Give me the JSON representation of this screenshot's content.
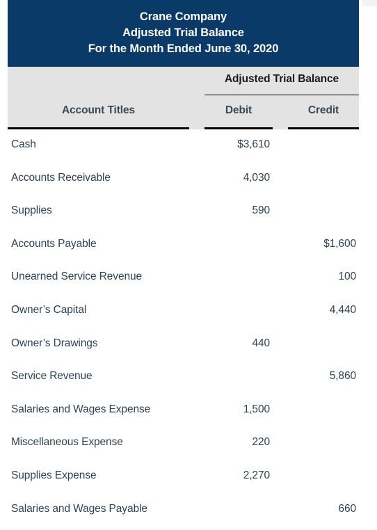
{
  "colors": {
    "header_blue": "#0a3a68",
    "header_grey": "#e3e3e3",
    "rule_black": "#000000",
    "body_text": "#2f4254",
    "page_background": "#ffffff"
  },
  "title_block": {
    "company": "Crane Company",
    "statement": "Adjusted Trial Balance",
    "period": "For the Month Ended June 30, 2020"
  },
  "table": {
    "group_header": "Adjusted Trial Balance",
    "columns": {
      "accounts": "Account Titles",
      "debit": "Debit",
      "credit": "Credit"
    },
    "rows": [
      {
        "account": "Cash",
        "debit": "$3,610",
        "credit": ""
      },
      {
        "account": "Accounts Receivable",
        "debit": "4,030",
        "credit": ""
      },
      {
        "account": "Supplies",
        "debit": "590",
        "credit": ""
      },
      {
        "account": "Accounts Payable",
        "debit": "",
        "credit": "$1,600"
      },
      {
        "account": "Unearned Service Revenue",
        "debit": "",
        "credit": "100"
      },
      {
        "account": "Owner’s Capital",
        "debit": "",
        "credit": "4,440"
      },
      {
        "account": "Owner’s Drawings",
        "debit": "440",
        "credit": ""
      },
      {
        "account": "Service Revenue",
        "debit": "",
        "credit": "5,860"
      },
      {
        "account": "Salaries and Wages Expense",
        "debit": "1,500",
        "credit": ""
      },
      {
        "account": "Miscellaneous Expense",
        "debit": "220",
        "credit": ""
      },
      {
        "account": "Supplies Expense",
        "debit": "2,270",
        "credit": ""
      },
      {
        "account": "Salaries and Wages Payable",
        "debit": "",
        "credit": "660"
      }
    ]
  }
}
